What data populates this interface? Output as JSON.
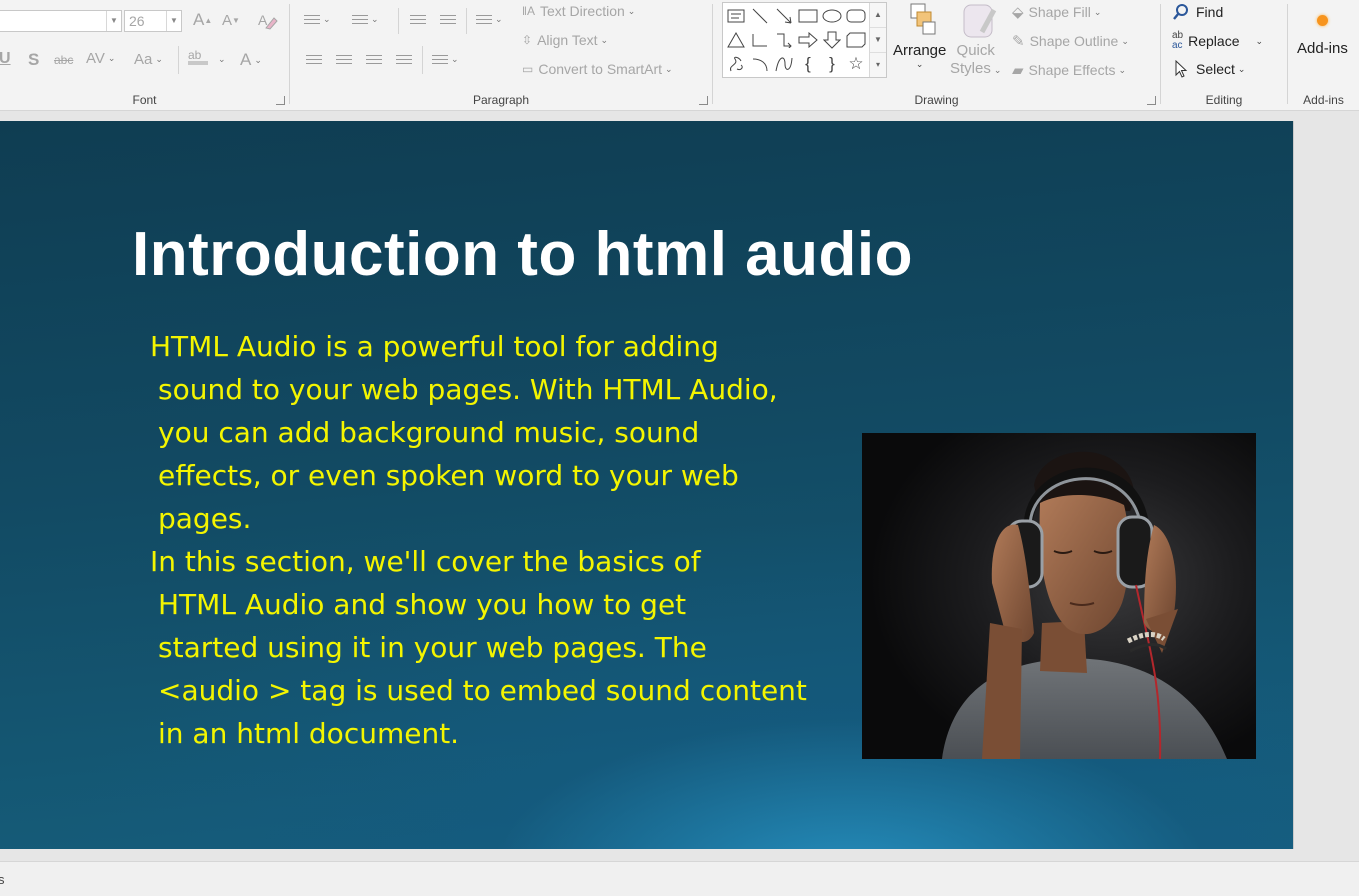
{
  "ribbon": {
    "font": {
      "label": "Font",
      "font_name": "",
      "font_size": "26",
      "grow_icon": "A",
      "shrink_icon": "A",
      "underline_icon": "U",
      "shadow_icon": "S",
      "strikethrough_icon": "abc",
      "spacing_icon": "AV",
      "case_icon": "Aa",
      "highlight_icon": "ab",
      "font_color_icon": "A"
    },
    "paragraph": {
      "label": "Paragraph",
      "text_direction": "Text Direction",
      "align_text": "Align Text",
      "convert_smartart": "Convert to SmartArt"
    },
    "drawing": {
      "label": "Drawing",
      "arrange": "Arrange",
      "quick_styles_line1": "Quick",
      "quick_styles_line2": "Styles",
      "shape_fill": "Shape Fill",
      "shape_outline": "Shape Outline",
      "shape_effects": "Shape Effects"
    },
    "editing": {
      "label": "Editing",
      "find": "Find",
      "replace": "Replace",
      "select": "Select",
      "replace_icon_top": "ab",
      "replace_icon_bottom": "ac"
    },
    "addins": {
      "label": "Add-ins",
      "button": "Add-ins"
    }
  },
  "slide": {
    "title": "Introduction to html audio",
    "body_lines": [
      "HTML Audio is a powerful tool for adding",
      "sound to your web pages. With HTML Audio,",
      "you can add background music, sound",
      "effects, or  even spoken word to your web",
      "pages.",
      "In this  section, we'll cover the basics of",
      "HTML Audio  and show you how to get",
      "started using it in your web pages. The",
      "<audio > tag is used to embed sound content",
      "in an html document."
    ]
  },
  "statusbar": {
    "text": "s"
  },
  "colors": {
    "title": "#ffffff",
    "body_text": "#f4f500",
    "slide_bg_dark": "#0f3d52",
    "slide_bg_light": "#1e87b5",
    "ribbon_bg": "#f3f3f3",
    "accent_blue": "#2b579a",
    "addins_dot": "#f7941d"
  }
}
